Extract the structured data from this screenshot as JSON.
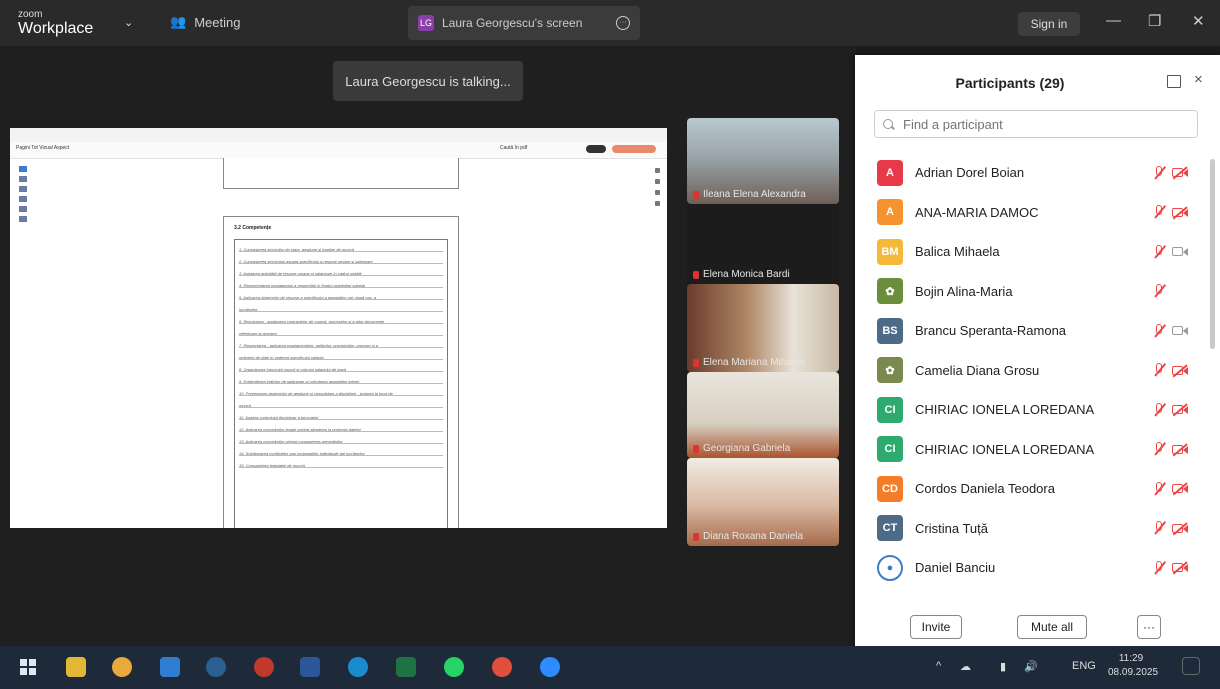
{
  "titlebar": {
    "logo_top": "zoom",
    "logo_bottom": "Workplace",
    "meeting_label": "Meeting",
    "share_tab_label": "Laura Georgescu's screen",
    "share_tab_avatar": "LG",
    "sign_in": "Sign in"
  },
  "stage": {
    "talking_notice": "Laura Georgescu is talking...",
    "shared_doc": {
      "toolbar_tabs": "Pagini  Tot  Vizual  Aspect",
      "find_label": "Caută în pdf",
      "section_heading": "3.2 Competențe",
      "lines": [
        "1.  Cunoașterea serviciilor de stare, gestiune și îngrijire de muncă",
        "2.  Cunoașterea serviciului asupra specificului a resurse umane și salarizare",
        "3.  Asistarea activității de resurse umane și salarizare în cadrul unității",
        "4.  Reprezentarea managerului a respectării în fondul asistențial salarial",
        "5.  Aplicarea sistemelor de resurse a specificului a angajaților ore, după caz, a",
        "    lucrătorilor",
        "6.  Rezolvarea - analizarea contractelor de muncă, proceselor și a altor documente",
        "    referitoare la acestea",
        "7.  Respectarea - aplicarea regulamentelor, politicilor, procedurilor, procese și a",
        "    ordinelor de date în vederea specificului salarial",
        "8.  Organizarea întocmirii muncii și calculul salariului de bază",
        "9.  Evidențierea indicilor de salarizare și calcularea angajaților interni",
        "10. Prezentarea aspectelor de gestiune și consolidare a disciplinei - izolarea la locul de",
        "    muncă",
        "11. Analiza controlului disciplinar a birocrației",
        "12. Aplicarea procedurilor legale privind atingerea la protecția datelor",
        "13. Aplicarea procedurilor privind cunoașterea prevederilor",
        "14. Soluționarea conflictelor sau reclamațiilor individuale ale lucrătorilor",
        "15. Cunoașterea legislației de muncă"
      ]
    },
    "video_tiles": [
      {
        "name": "Ileana Elena Alexandra"
      },
      {
        "name": "Elena Monica Bardi"
      },
      {
        "name": "Elena Mariana Mihaela"
      },
      {
        "name": "Georgiana Gabriela"
      },
      {
        "name": "Diana Roxana Daniela"
      }
    ]
  },
  "participants_panel": {
    "title": "Participants (29)",
    "search_placeholder": "Find a participant",
    "participants": [
      {
        "initials": "A",
        "name": "Adrian Dorel Boian",
        "avatar_color": "#e8394a",
        "camera": "off"
      },
      {
        "initials": "A",
        "name": "ANA-MARIA DAMOC",
        "avatar_color": "#f59331",
        "camera": "off"
      },
      {
        "initials": "BM",
        "name": "Balica Mihaela",
        "avatar_color": "#f5b93a",
        "camera": "on"
      },
      {
        "initials": "",
        "name": "Bojin Alina-Maria",
        "avatar_color": "#6b8e3d",
        "camera": "none"
      },
      {
        "initials": "BS",
        "name": "Brancu Speranta-Ramona",
        "avatar_color": "#4d6a86",
        "camera": "on"
      },
      {
        "initials": "",
        "name": "Camelia Diana Grosu",
        "avatar_color": "#7a8a4e",
        "camera": "off"
      },
      {
        "initials": "CI",
        "name": "CHIRIAC IONELA LOREDANA",
        "avatar_color": "#2eaa6e",
        "camera": "off"
      },
      {
        "initials": "CI",
        "name": "CHIRIAC IONELA LOREDANA",
        "avatar_color": "#2eaa6e",
        "camera": "off"
      },
      {
        "initials": "CD",
        "name": "Cordos Daniela Teodora",
        "avatar_color": "#f57d2a",
        "camera": "off"
      },
      {
        "initials": "CT",
        "name": "Cristina Tuță",
        "avatar_color": "#4d6a86",
        "camera": "off"
      },
      {
        "initials": "",
        "name": "Daniel Banciu",
        "avatar_color": "#3d7cc9",
        "camera": "off"
      }
    ],
    "buttons": {
      "invite": "Invite",
      "mute_all": "Mute all",
      "more": "···"
    }
  },
  "taskbar": {
    "lang": "ENG",
    "time": "11:29",
    "date": "08.09.2025"
  },
  "colors": {
    "accent_red": "#e44444",
    "panel_bg": "#ffffff",
    "titlebar_bg": "#2a2a2a"
  }
}
